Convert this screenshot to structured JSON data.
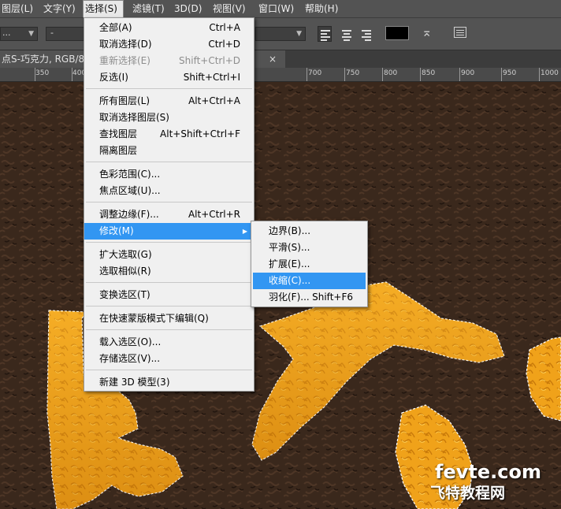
{
  "menubar": {
    "items": [
      "图层(L)",
      "文字(Y)",
      "选择(S)",
      "滤镜(T)",
      "3D(D)",
      "视图(V)",
      "窗口(W)",
      "帮助(H)"
    ]
  },
  "options": {
    "font_family_value": "-",
    "font_style_value": "...",
    "text_color": "#000000"
  },
  "document": {
    "tab_title": "点S-巧克力, RGB/8",
    "close_glyph": "×"
  },
  "ruler": {
    "labels": [
      "350",
      "400",
      "700",
      "750",
      "800",
      "850",
      "900",
      "950",
      "1000",
      "10"
    ]
  },
  "select_menu": {
    "items": [
      {
        "label": "全部(A)",
        "shortcut": "Ctrl+A"
      },
      {
        "label": "取消选择(D)",
        "shortcut": "Ctrl+D"
      },
      {
        "label": "重新选择(E)",
        "shortcut": "Shift+Ctrl+D"
      },
      {
        "label": "反选(I)",
        "shortcut": "Shift+Ctrl+I"
      },
      {
        "label": "所有图层(L)",
        "shortcut": "Alt+Ctrl+A"
      },
      {
        "label": "取消选择图层(S)",
        "shortcut": ""
      },
      {
        "label": "查找图层",
        "shortcut": "Alt+Shift+Ctrl+F"
      },
      {
        "label": "隔离图层",
        "shortcut": ""
      },
      {
        "label": "色彩范围(C)...",
        "shortcut": ""
      },
      {
        "label": "焦点区域(U)...",
        "shortcut": ""
      },
      {
        "label": "调整边缘(F)...",
        "shortcut": "Alt+Ctrl+R"
      },
      {
        "label": "修改(M)",
        "shortcut": ""
      },
      {
        "label": "扩大选取(G)",
        "shortcut": ""
      },
      {
        "label": "选取相似(R)",
        "shortcut": ""
      },
      {
        "label": "变换选区(T)",
        "shortcut": ""
      },
      {
        "label": "在快速蒙版模式下编辑(Q)",
        "shortcut": ""
      },
      {
        "label": "载入选区(O)...",
        "shortcut": ""
      },
      {
        "label": "存储选区(V)...",
        "shortcut": ""
      },
      {
        "label": "新建 3D 模型(3)",
        "shortcut": ""
      }
    ]
  },
  "modify_submenu": {
    "items": [
      {
        "label": "边界(B)...",
        "shortcut": ""
      },
      {
        "label": "平滑(S)...",
        "shortcut": ""
      },
      {
        "label": "扩展(E)...",
        "shortcut": ""
      },
      {
        "label": "收缩(C)...",
        "shortcut": ""
      },
      {
        "label": "羽化(F)...",
        "shortcut": "Shift+F6"
      }
    ]
  },
  "watermark": {
    "site": "fevte.com",
    "name": "飞特教程网"
  },
  "colors": {
    "highlight": "#3296f2",
    "chocolate": "#3b2a1e",
    "orange": "#f0a21a"
  }
}
